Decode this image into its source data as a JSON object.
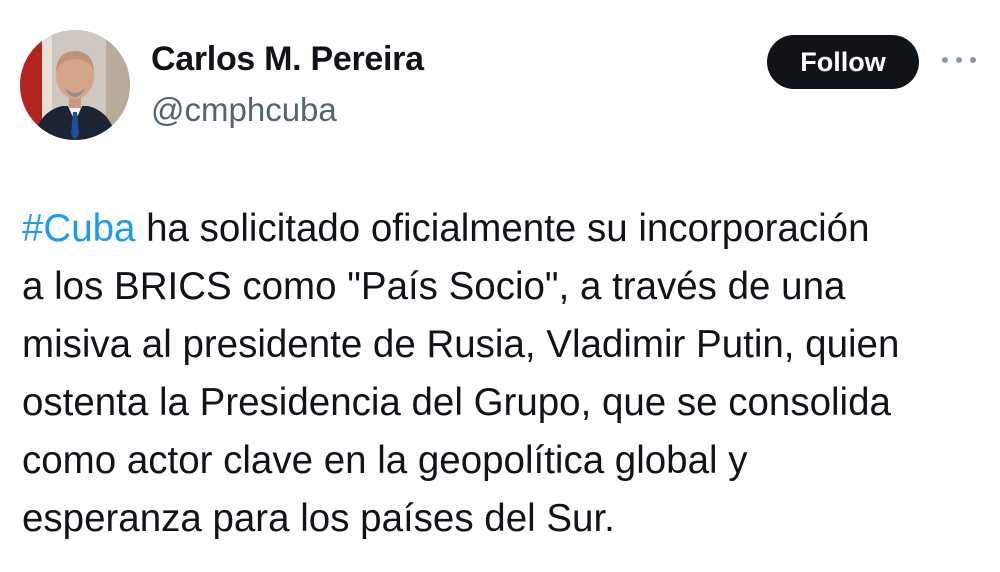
{
  "author": {
    "name": "Carlos M. Pereira",
    "handle": "@cmphcuba"
  },
  "actions": {
    "follow_label": "Follow",
    "more_icon": "more-horizontal-icon"
  },
  "tweet": {
    "hashtag": "#Cuba",
    "line1_rest": " ha solicitado oficialmente su incorporación",
    "lines": [
      "a los BRICS como \"País Socio\", a través de una",
      "misiva al presidente de Rusia, Vladimir Putin, quien",
      "ostenta la Presidencia del Grupo, que se consolida",
      "como actor clave en la geopolítica global y",
      "esperanza para los países del Sur."
    ]
  },
  "colors": {
    "link": "#1d9bf0",
    "text": "#0f1419",
    "secondary": "#536471",
    "button_bg": "#0f1419"
  }
}
